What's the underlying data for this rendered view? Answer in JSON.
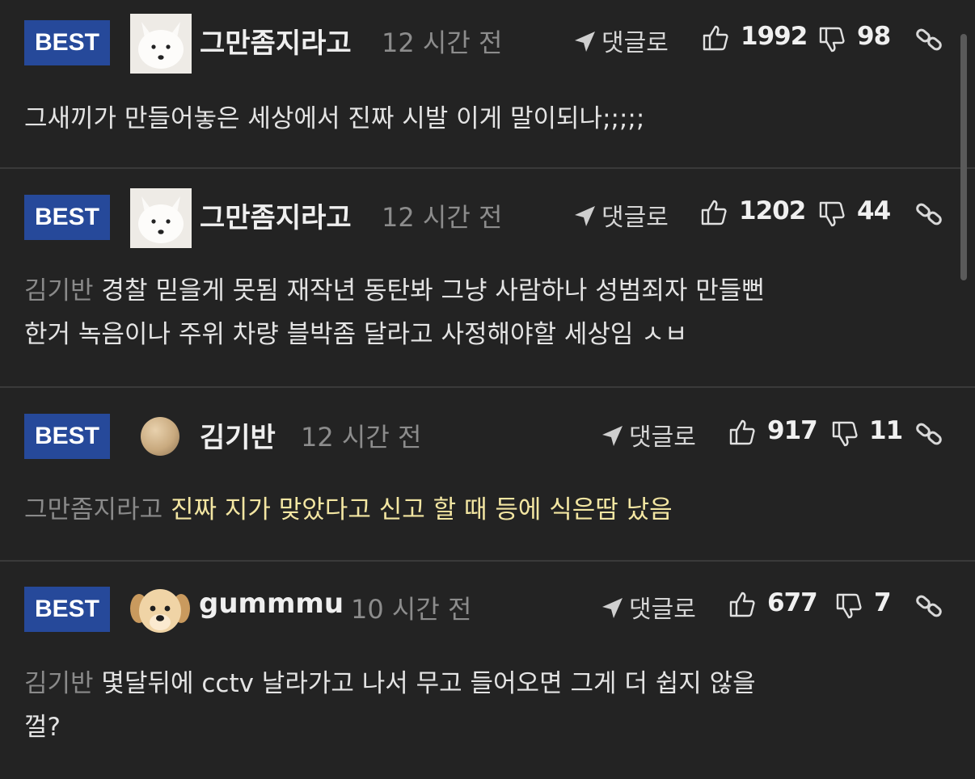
{
  "ui": {
    "reply_label": "댓글로",
    "best_label": "BEST"
  },
  "comments": [
    {
      "username": "그만좀지라고",
      "time": "12 시간 전",
      "likes": "1992",
      "dislikes": "98",
      "mention": "",
      "text": "그새끼가 만들어놓은 세상에서 진짜 시발 이게 말이되나;;;;;",
      "avatar": "white-fox-avatar"
    },
    {
      "username": "그만좀지라고",
      "time": "12 시간 전",
      "likes": "1202",
      "dislikes": "44",
      "mention": "김기반",
      "text": "경찰 믿을게 못됨 재작년 동탄봐 그냥 사람하나 성범죄자 만들뻔",
      "text_line2": "한거 녹음이나 주위 차량 블박좀 달라고 사정해야할 세상임 ㅅㅂ",
      "avatar": "white-fox-avatar"
    },
    {
      "username": "김기반",
      "time": "12 시간 전",
      "likes": "917",
      "dislikes": "11",
      "mention": "그만좀지라고",
      "text": "진짜 지가 맞았다고 신고 할 때 등에 식은땀 났음",
      "avatar": "beige-circle-avatar"
    },
    {
      "username": "gummmu",
      "time": "10 시간 전",
      "likes": "677",
      "dislikes": "7",
      "mention": "김기반",
      "text": "몇달뒤에 cctv 날라가고 나서 무고 들어오면 그게 더 쉽지 않을",
      "text_line2": "껄?",
      "avatar": "puppy-avatar"
    }
  ],
  "colors": {
    "background": "#232323",
    "best_badge": "#26499a",
    "highlight_text": "#f3e6a2",
    "mention_text": "#8a8a8a"
  }
}
